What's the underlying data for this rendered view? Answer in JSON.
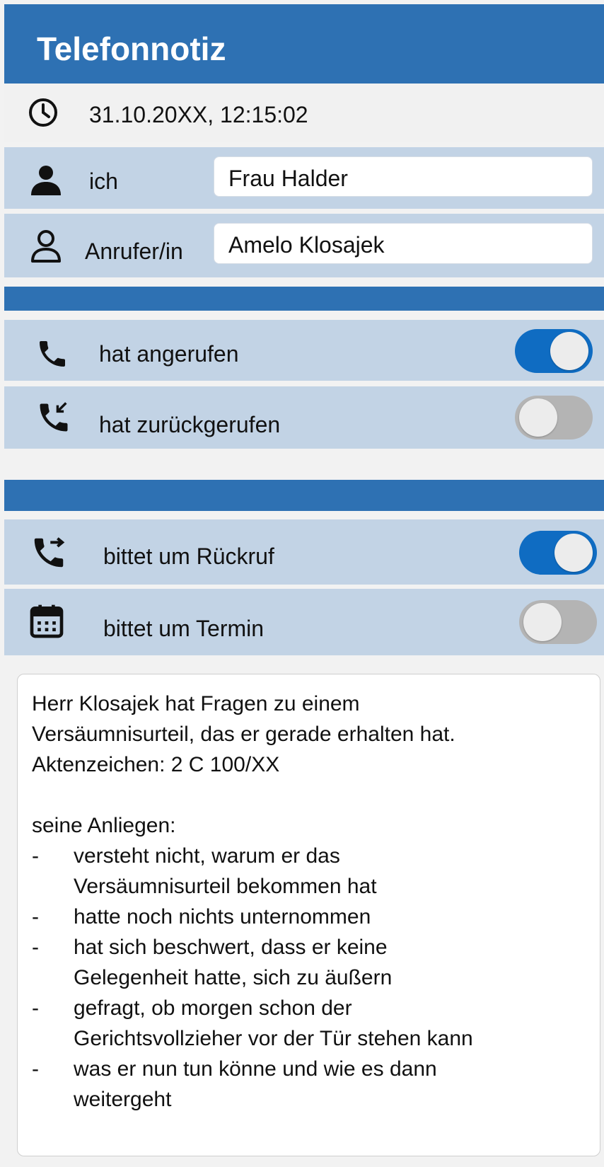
{
  "header": {
    "title": "Telefonnotiz"
  },
  "timestamp": {
    "value": "31.10.20XX, 12:15:02",
    "icon": "clock-icon"
  },
  "me": {
    "label": "ich",
    "value": "Frau Halder",
    "icon": "person-filled-icon"
  },
  "caller": {
    "label": "Anrufer/in",
    "value": "Amelo Klosajek",
    "icon": "person-outline-icon"
  },
  "toggles": [
    {
      "label": "hat angerufen",
      "on": true,
      "icon": "phone-icon"
    },
    {
      "label": "hat zurückgerufen",
      "on": false,
      "icon": "phone-callback-icon"
    },
    {
      "label": "bittet um Rückruf",
      "on": true,
      "icon": "phone-forward-icon"
    },
    {
      "label": "bittet um Termin",
      "on": false,
      "icon": "calendar-icon"
    }
  ],
  "notes": {
    "intro": [
      "Herr Klosajek hat Fragen zu einem",
      "Versäumnisurteil, das er gerade erhalten hat.",
      "Aktenzeichen: 2 C 100/XX"
    ],
    "heading": "seine Anliegen:",
    "items": [
      [
        "versteht nicht, warum er das",
        "Versäumnisurteil bekommen hat"
      ],
      [
        "hatte noch nichts unternommen"
      ],
      [
        "hat sich beschwert, dass er keine",
        "Gelegenheit hatte, sich zu äußern"
      ],
      [
        "gefragt, ob morgen schon der",
        "Gerichtsvollzieher vor der Tür stehen kann"
      ],
      [
        "was er nun tun könne und wie es dann",
        "weitergeht"
      ]
    ],
    "dash": "-"
  },
  "colors": {
    "header": "#2e71b3",
    "row": "#c2d3e5",
    "toggle_on": "#0f6cc2",
    "toggle_off": "#b4b4b4"
  }
}
